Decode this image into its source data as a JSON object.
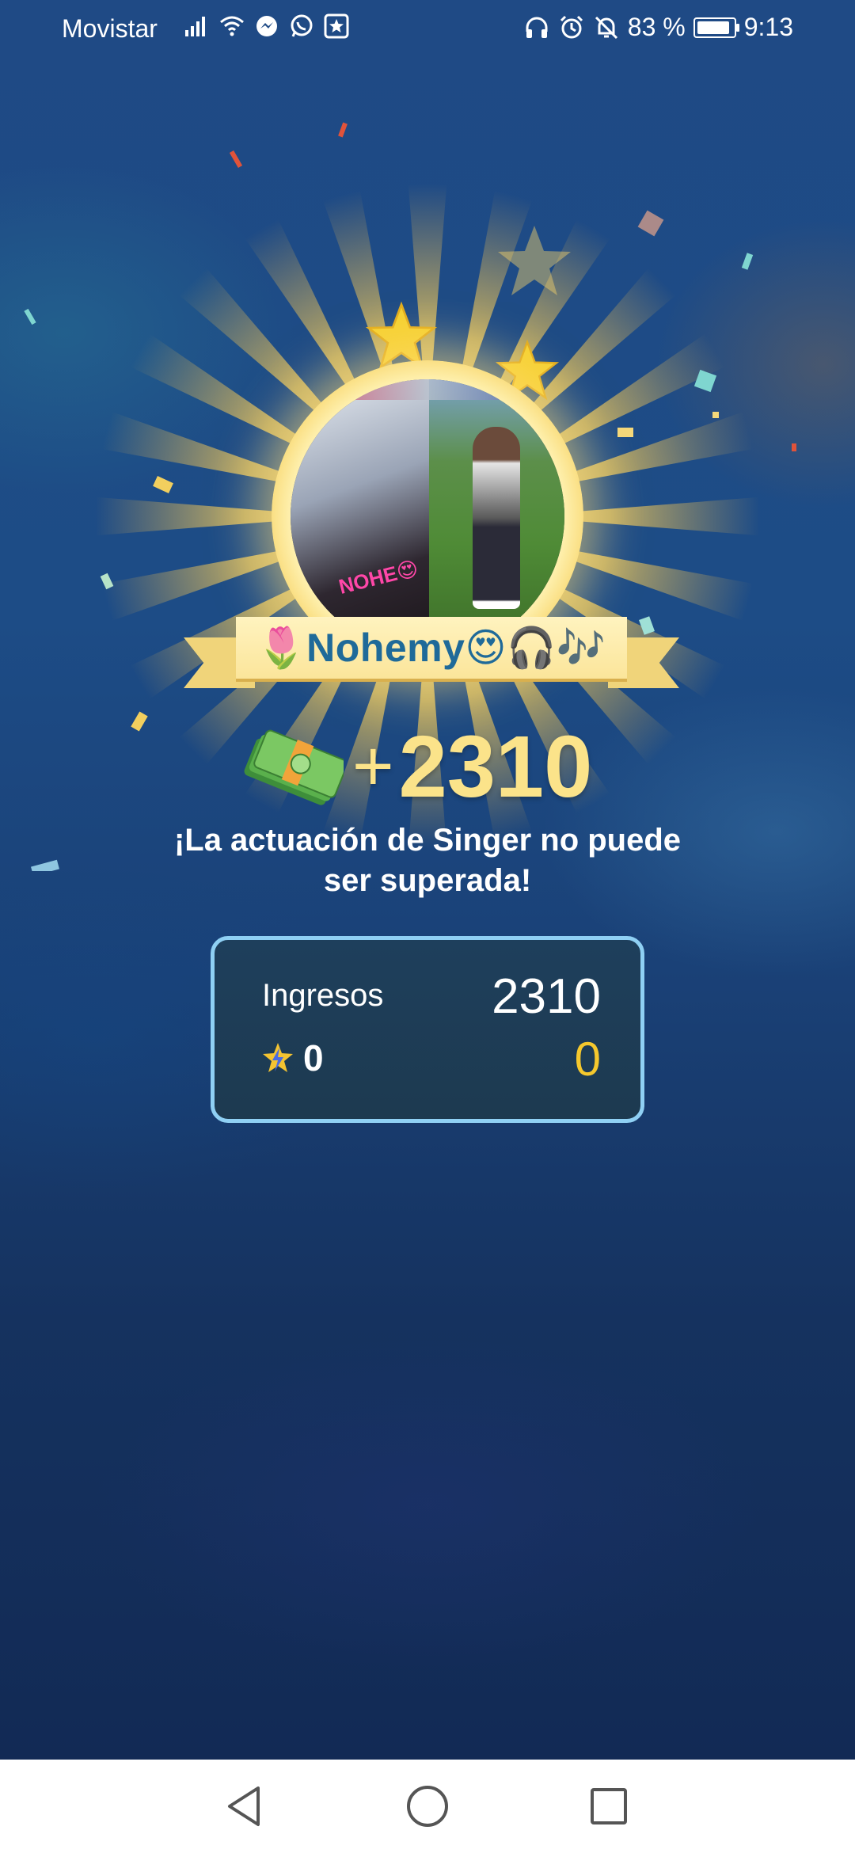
{
  "status_bar": {
    "carrier": "Movistar",
    "battery_percent": "83 %",
    "time": "9:13",
    "left_icons": [
      "signal-icon",
      "wifi-icon",
      "messenger-icon",
      "whatsapp-icon",
      "star-app-icon"
    ],
    "right_icons": [
      "headphones-icon",
      "alarm-icon",
      "mute-bell-icon",
      "battery-icon"
    ]
  },
  "performer": {
    "name": "🌷Nohemy😍🎧🎶",
    "avatar_sticker": "NOHE😍"
  },
  "reward": {
    "prefix": "+",
    "amount": "2310",
    "icon": "cash-stack-icon"
  },
  "message": "¡La actuación de Singer no puede ser superada!",
  "income_panel": {
    "income_label": "Ingresos",
    "income_value": "2310",
    "bonus_label": "0",
    "bonus_value": "0",
    "accent_color": "#f5c82d",
    "border_color": "#8fd0f4"
  },
  "navigation": {
    "back": "back-icon",
    "home": "home-icon",
    "recents": "recents-icon"
  },
  "colors": {
    "name_text": "#1f6a99",
    "reward_text": "#fbe38a",
    "ribbon": "#fbe59a"
  }
}
